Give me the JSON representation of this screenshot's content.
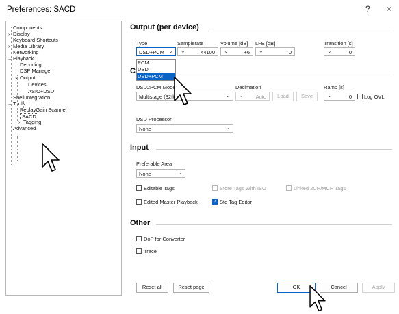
{
  "window": {
    "title": "Preferences: SACD",
    "help_label": "?",
    "close_label": "×"
  },
  "tree": {
    "items": [
      {
        "label": "Components"
      },
      {
        "label": "Display"
      },
      {
        "label": "Keyboard Shortcuts"
      },
      {
        "label": "Media Library"
      },
      {
        "label": "Networking"
      },
      {
        "label": "Playback"
      },
      {
        "label": "Decoding"
      },
      {
        "label": "DSP Manager"
      },
      {
        "label": "Output"
      },
      {
        "label": "Devices"
      },
      {
        "label": "ASIO+DSD"
      },
      {
        "label": "Shell Integration"
      },
      {
        "label": "Tools"
      },
      {
        "label": "ReplayGain Scanner"
      },
      {
        "label": "SACD"
      },
      {
        "label": "Tagging"
      },
      {
        "label": "Advanced"
      }
    ],
    "selected": "SACD"
  },
  "output": {
    "title": "Output (per device)",
    "type_label": "Type",
    "type_value": "DSD+PCM",
    "type_options": [
      "PCM",
      "DSD",
      "DSD+PCM"
    ],
    "samplerate_label": "Samplerate",
    "samplerate_value": "44100",
    "volume_label": "Volume [dB]",
    "volume_value": "+6",
    "lfe_label": "LFE [dB]",
    "lfe_value": "0",
    "transition_label": "Transition [s]",
    "transition_value": "0"
  },
  "conversion": {
    "title_partial": "C",
    "mode_label": "DSD2PCM Mode",
    "mode_value": "Multistage (32fk",
    "decimation_label": "Decimation",
    "decimation_value": "Auto",
    "load_label": "Load",
    "save_label": "Save",
    "ramp_label": "Ramp [s]",
    "ramp_value": "0",
    "log_ovl_label": "Log OVL",
    "processor_label": "DSD Processor",
    "processor_value": "None"
  },
  "input": {
    "title": "Input",
    "area_label": "Preferable Area",
    "area_value": "None",
    "editable_tags_label": "Editable Tags",
    "store_iso_label": "Store Tags With ISO",
    "linked_label": "Linked 2CH/MCH Tags",
    "edited_master_label": "Edited Master Playback",
    "std_tag_label": "Std Tag Editor"
  },
  "other": {
    "title": "Other",
    "dop_label": "DoP for Converter",
    "trace_label": "Trace"
  },
  "footer": {
    "reset_all": "Reset all",
    "reset_page": "Reset page",
    "ok": "OK",
    "cancel": "Cancel",
    "apply": "Apply"
  },
  "icons": {
    "chevron": "chevron-down-icon",
    "check": "check-icon",
    "cursor": "mouse-pointer-icon"
  },
  "colors": {
    "accent": "#0a64c8",
    "border": "#b6b6b6",
    "disabled": "#a0a0a0"
  }
}
